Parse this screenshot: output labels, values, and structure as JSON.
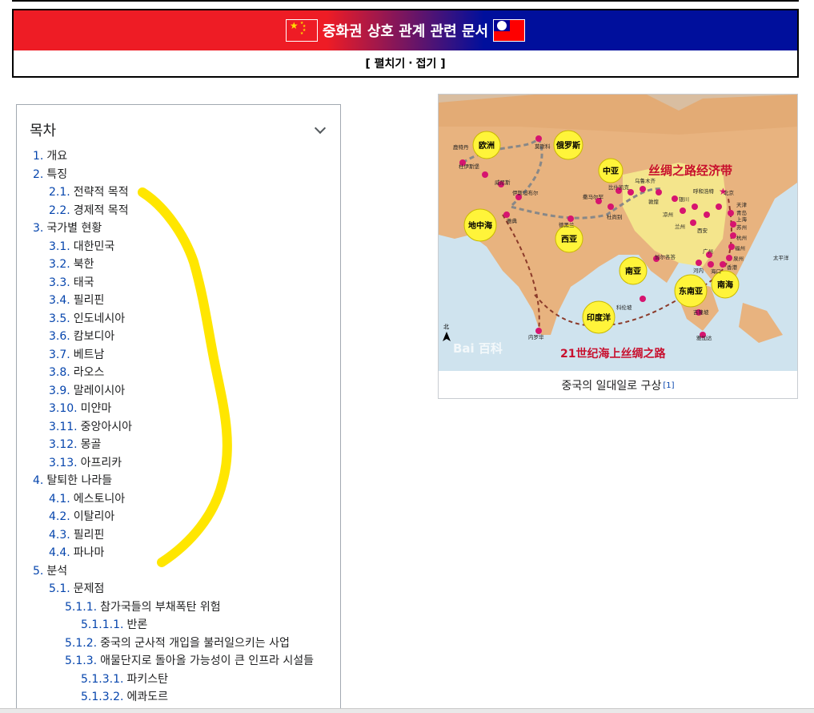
{
  "navbox": {
    "title": "중화권 상호 관계 관련 문서",
    "toggle_open": "[ 펼치기",
    "toggle_sep": "·",
    "toggle_close": "접기 ]"
  },
  "toc": {
    "title": "목차",
    "items": [
      {
        "num": "1.",
        "text": "개요",
        "level": 1
      },
      {
        "num": "2.",
        "text": "특징",
        "level": 1
      },
      {
        "num": "2.1.",
        "text": "전략적 목적",
        "level": 2
      },
      {
        "num": "2.2.",
        "text": "경제적 목적",
        "level": 2
      },
      {
        "num": "3.",
        "text": "국가별 현황",
        "level": 1
      },
      {
        "num": "3.1.",
        "text": "대한민국",
        "level": 2
      },
      {
        "num": "3.2.",
        "text": "북한",
        "level": 2
      },
      {
        "num": "3.3.",
        "text": "태국",
        "level": 2
      },
      {
        "num": "3.4.",
        "text": "필리핀",
        "level": 2
      },
      {
        "num": "3.5.",
        "text": "인도네시아",
        "level": 2
      },
      {
        "num": "3.6.",
        "text": "캄보디아",
        "level": 2
      },
      {
        "num": "3.7.",
        "text": "베트남",
        "level": 2
      },
      {
        "num": "3.8.",
        "text": "라오스",
        "level": 2
      },
      {
        "num": "3.9.",
        "text": "말레이시아",
        "level": 2
      },
      {
        "num": "3.10.",
        "text": "미얀마",
        "level": 2
      },
      {
        "num": "3.11.",
        "text": "중앙아시아",
        "level": 2
      },
      {
        "num": "3.12.",
        "text": "몽골",
        "level": 2
      },
      {
        "num": "3.13.",
        "text": "아프리카",
        "level": 2
      },
      {
        "num": "4.",
        "text": "탈퇴한 나라들",
        "level": 1
      },
      {
        "num": "4.1.",
        "text": "에스토니아",
        "level": 2
      },
      {
        "num": "4.2.",
        "text": "이탈리아",
        "level": 2
      },
      {
        "num": "4.3.",
        "text": "필리핀",
        "level": 2
      },
      {
        "num": "4.4.",
        "text": "파나마",
        "level": 2
      },
      {
        "num": "5.",
        "text": "분석",
        "level": 1
      },
      {
        "num": "5.1.",
        "text": "문제점",
        "level": 2
      },
      {
        "num": "5.1.1.",
        "text": "참가국들의 부채폭탄 위험",
        "level": 3
      },
      {
        "num": "5.1.1.1.",
        "text": "반론",
        "level": 4
      },
      {
        "num": "5.1.2.",
        "text": "중국의 군사적 개입을 불러일으키는 사업",
        "level": 3
      },
      {
        "num": "5.1.3.",
        "text": "애물단지로 돌아올 가능성이 큰 인프라 시설들",
        "level": 3
      },
      {
        "num": "5.1.3.1.",
        "text": "파키스탄",
        "level": 4
      },
      {
        "num": "5.1.3.2.",
        "text": "에콰도르",
        "level": 4
      }
    ]
  },
  "figure": {
    "map_title": "丝绸之路经济带",
    "map_subtitle": "21世纪海上丝绸之路",
    "regions": [
      "欧洲",
      "俄罗斯",
      "中亚",
      "地中海",
      "西亚",
      "南亚",
      "东南亚",
      "南海",
      "印度洋"
    ],
    "cities": [
      "北京",
      "天津",
      "青岛",
      "上海",
      "苏州",
      "杭州",
      "福州",
      "泉州",
      "香港",
      "广州",
      "海口",
      "乌鲁木齐",
      "呼和浩特",
      "敦煌",
      "银川",
      "凉州",
      "兰州",
      "西安",
      "比什凯克",
      "撒马尔罕",
      "杜尚别",
      "德黑兰",
      "伊斯坦布尔",
      "雅典",
      "威尼斯",
      "鹿特丹",
      "杜伊斯堡",
      "莫斯科",
      "加尔各答",
      "河内",
      "科伦坡",
      "吉隆坡",
      "雅加达",
      "内罗毕"
    ],
    "ocean_label": "太平洋",
    "north_label": "北",
    "watermark": "Bai 百科",
    "caption": "중국의 일대일로 구상",
    "ref": "[1]"
  },
  "colors": {
    "flag_red": "#ee1c25",
    "flag_blue": "#000f9c",
    "link": "#0645ad",
    "highlight": "#ffe600",
    "route_dot": "#d6146f"
  }
}
